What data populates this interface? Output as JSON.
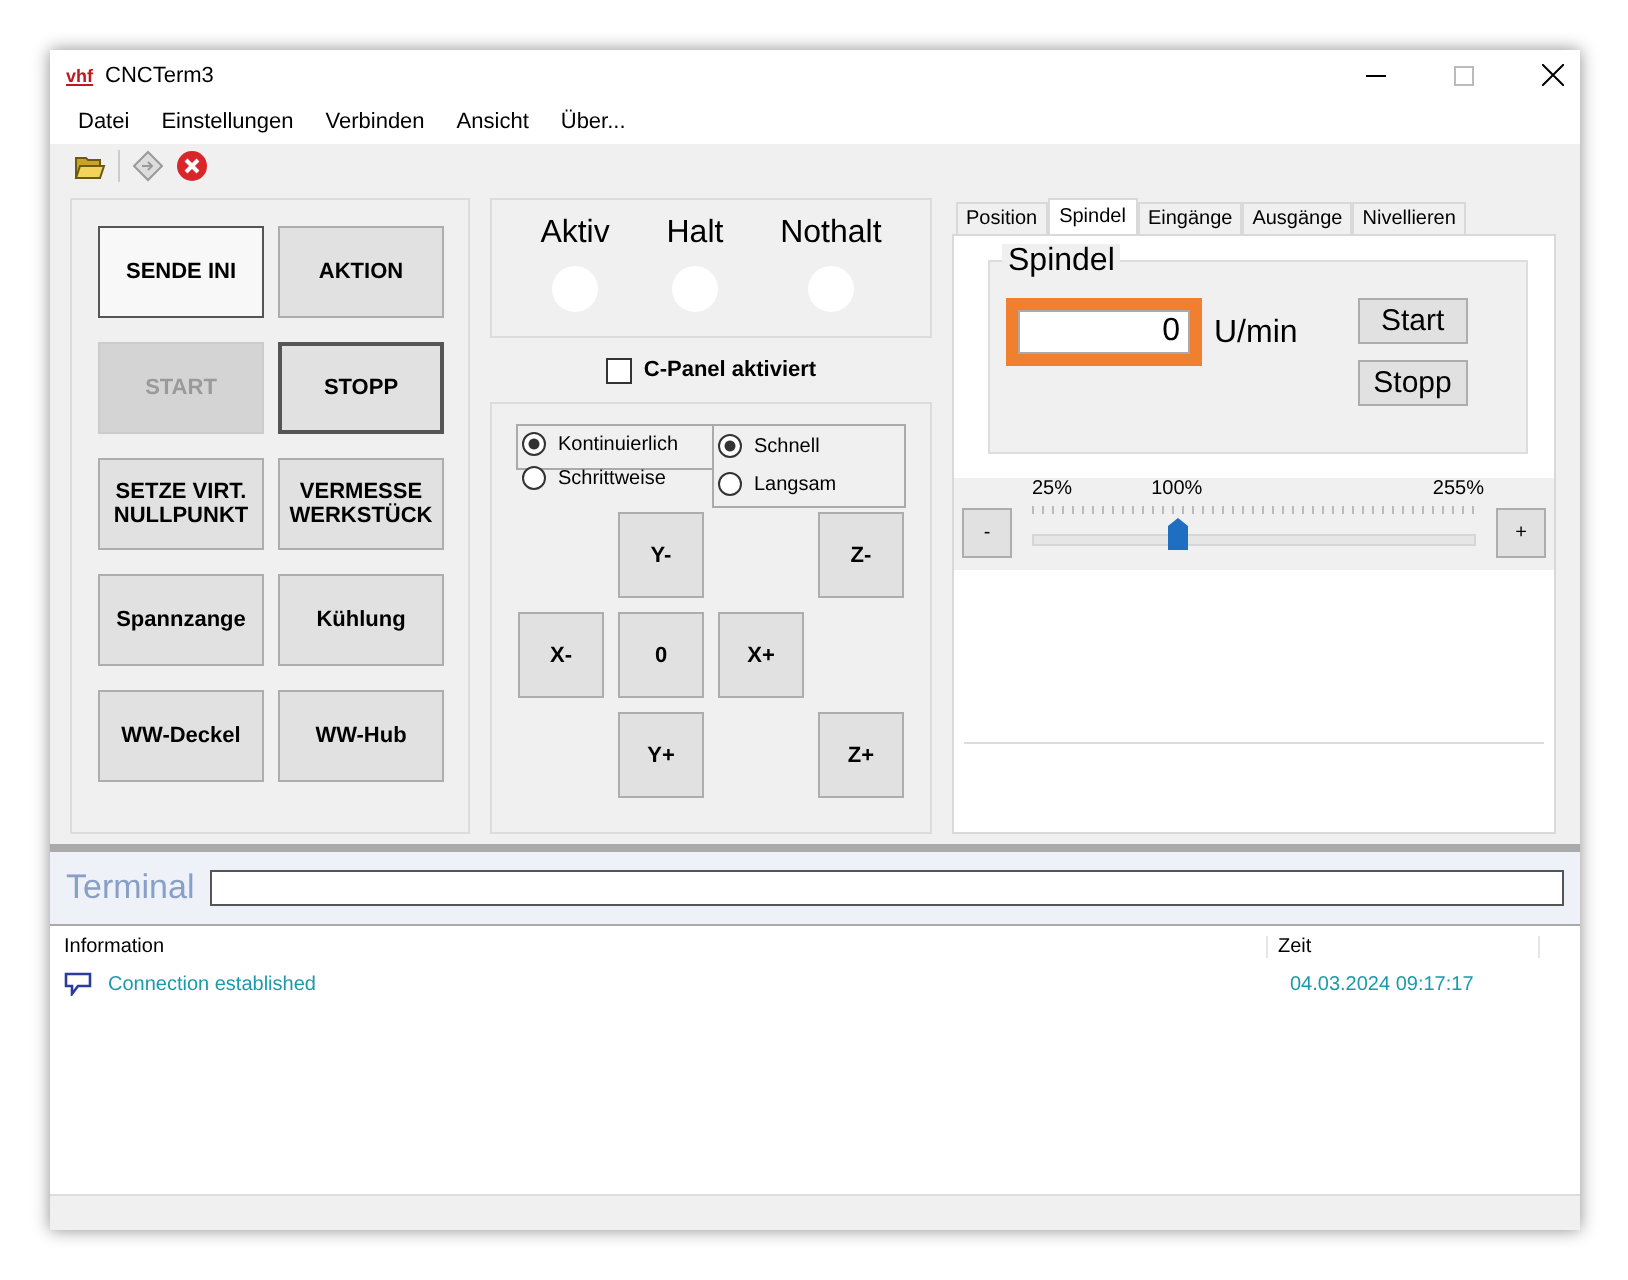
{
  "window": {
    "title": "CNCTerm3",
    "logo": "vhf"
  },
  "menu": [
    "Datei",
    "Einstellungen",
    "Verbinden",
    "Ansicht",
    "Über..."
  ],
  "actions": [
    {
      "label": "SENDE INI",
      "kind": "focused",
      "disabled": false
    },
    {
      "label": "AKTION",
      "kind": "normal",
      "disabled": false
    },
    {
      "label": "START",
      "kind": "normal",
      "disabled": true
    },
    {
      "label": "STOPP",
      "kind": "default",
      "disabled": false
    },
    {
      "label": "SETZE VIRT.\nNULLPUNKT",
      "kind": "normal",
      "disabled": false
    },
    {
      "label": "VERMESSE\nWERKSTÜCK",
      "kind": "normal",
      "disabled": false
    },
    {
      "label": "Spannzange",
      "kind": "normal",
      "disabled": false
    },
    {
      "label": "Kühlung",
      "kind": "normal",
      "disabled": false
    },
    {
      "label": "WW-Deckel",
      "kind": "normal",
      "disabled": false
    },
    {
      "label": "WW-Hub",
      "kind": "normal",
      "disabled": false
    }
  ],
  "lamps": [
    {
      "label": "Aktiv",
      "on": false
    },
    {
      "label": "Halt",
      "on": false
    },
    {
      "label": "Nothalt",
      "on": false
    }
  ],
  "cpanel": {
    "label": "C-Panel aktiviert",
    "checked": false
  },
  "mode": [
    {
      "label": "Kontinuierlich",
      "selected": true
    },
    {
      "label": "Schrittweise",
      "selected": false
    }
  ],
  "speed": [
    {
      "label": "Schnell",
      "selected": true
    },
    {
      "label": "Langsam",
      "selected": false
    }
  ],
  "jog": [
    "Y-",
    "Z-",
    "X-",
    "0",
    "X+",
    "Y+",
    "Z+"
  ],
  "tabs": [
    {
      "label": "Position",
      "selected": false
    },
    {
      "label": "Spindel",
      "selected": true
    },
    {
      "label": "Eingänge",
      "selected": false
    },
    {
      "label": "Ausgänge",
      "selected": false
    },
    {
      "label": "Nivellieren",
      "selected": false
    }
  ],
  "spindle": {
    "title": "Spindel",
    "value": "0",
    "unit": "U/min",
    "highlighted": true,
    "buttons": [
      "Start",
      "Stopp"
    ]
  },
  "override": {
    "minus": "-",
    "plus": "+",
    "min_label": "25%",
    "mid_label": "100%",
    "max_label": "255%",
    "level": 0.326
  },
  "terminal": {
    "label": "Terminal"
  },
  "log": {
    "columns": [
      "Information",
      "Zeit"
    ],
    "rows": [
      {
        "message": "Connection established",
        "time": "04.03.2024 09:17:17"
      }
    ]
  }
}
